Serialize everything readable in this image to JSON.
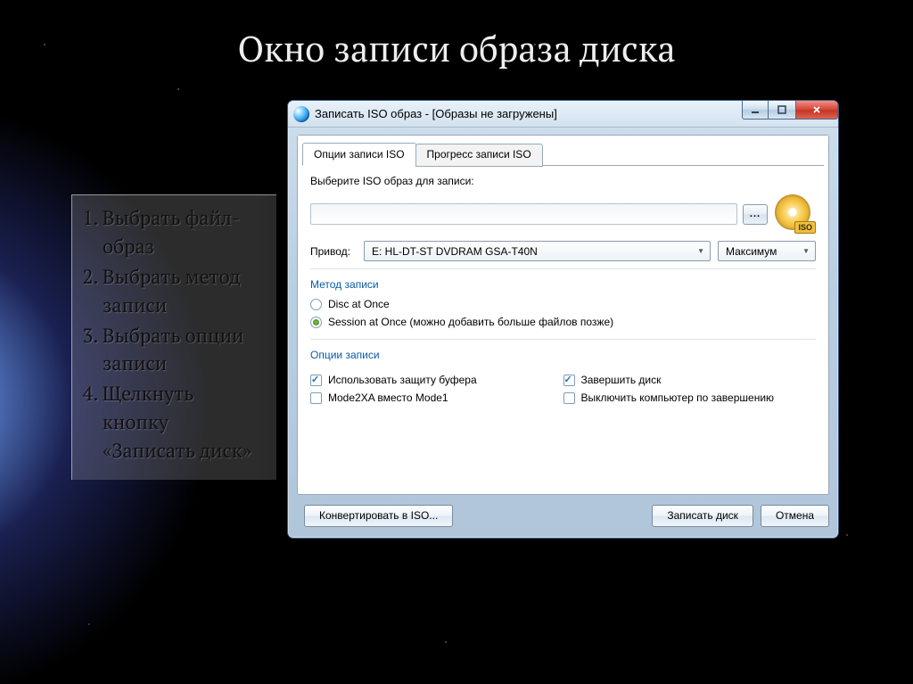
{
  "slide_title": "Окно записи образа диска",
  "steps": [
    "Выбрать файл-образ",
    "Выбрать метод записи",
    "Выбрать опции записи",
    "Щелкнуть кнопку «Записать диск»"
  ],
  "window": {
    "title": "Записать ISO образ - [Образы не загружены]",
    "tabs": {
      "active": "Опции записи ISO",
      "inactive": "Прогресс записи ISO"
    },
    "select_label": "Выберите ISO образ для записи:",
    "iso_badge": "ISO",
    "drive_label": "Привод:",
    "drive_value": "E: HL-DT-ST DVDRAM GSA-T40N",
    "speed_value": "Максимум",
    "method_section": "Метод записи",
    "method": {
      "dao": "Disc at Once",
      "sao": "Session at Once (можно добавить больше файлов позже)"
    },
    "options_section": "Опции записи",
    "options": {
      "buffer": "Использовать защиту буфера",
      "finalize": "Завершить диск",
      "mode2xa": "Mode2XA вместо Mode1",
      "shutdown": "Выключить компьютер по завершению"
    },
    "buttons": {
      "convert": "Конвертировать в ISO...",
      "burn": "Записать диск",
      "cancel": "Отмена"
    }
  }
}
